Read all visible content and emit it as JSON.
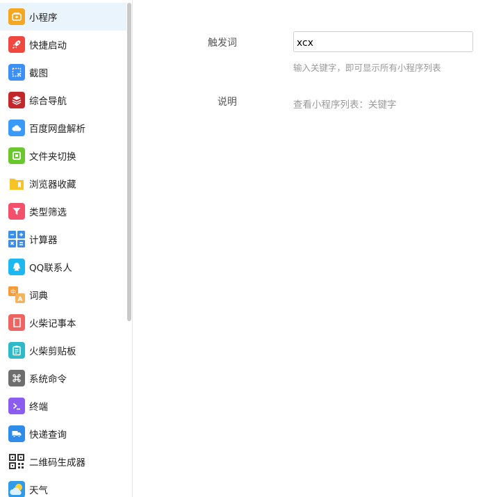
{
  "sidebar": {
    "items": [
      {
        "label": "小程序",
        "icon": "mini-program-icon",
        "color": "#f5a623",
        "active": true
      },
      {
        "label": "快捷启动",
        "icon": "rocket-icon",
        "color": "#f0483e"
      },
      {
        "label": "截图",
        "icon": "screenshot-icon",
        "color": "#3b8ff5"
      },
      {
        "label": "综合导航",
        "icon": "layers-icon",
        "color": "#c3282d"
      },
      {
        "label": "百度网盘解析",
        "icon": "cloud-icon",
        "color": "#3a9af7"
      },
      {
        "label": "文件夹切换",
        "icon": "folder-switch-icon",
        "color": "#6bc72e"
      },
      {
        "label": "浏览器收藏",
        "icon": "bookmark-folder-icon",
        "color": "#f7c325"
      },
      {
        "label": "类型筛选",
        "icon": "filter-icon",
        "color": "#f2506b"
      },
      {
        "label": "计算器",
        "icon": "calculator-icon",
        "color": "#3a8de8"
      },
      {
        "label": "QQ联系人",
        "icon": "qq-icon",
        "color": "#1eb8f0"
      },
      {
        "label": "词典",
        "icon": "dictionary-icon",
        "color": "#f59a38"
      },
      {
        "label": "火柴记事本",
        "icon": "notebook-icon",
        "color": "#ee6461"
      },
      {
        "label": "火柴剪贴板",
        "icon": "clipboard-icon",
        "color": "#2fb9c4"
      },
      {
        "label": "系统命令",
        "icon": "command-icon",
        "color": "#6e6e6e"
      },
      {
        "label": "终端",
        "icon": "terminal-icon",
        "color": "#8a5cf0"
      },
      {
        "label": "快递查询",
        "icon": "delivery-truck-icon",
        "color": "#2f8ce8"
      },
      {
        "label": "二维码生成器",
        "icon": "qr-code-icon",
        "color": "#333333"
      },
      {
        "label": "天气",
        "icon": "weather-icon",
        "color": "#2e9bea"
      }
    ]
  },
  "form": {
    "trigger_label": "触发词",
    "trigger_value": "xcx",
    "trigger_hint": "输入关键字，即可显示所有小程序列表",
    "description_label": "说明",
    "description_text": "查看小程序列表：关键字"
  }
}
